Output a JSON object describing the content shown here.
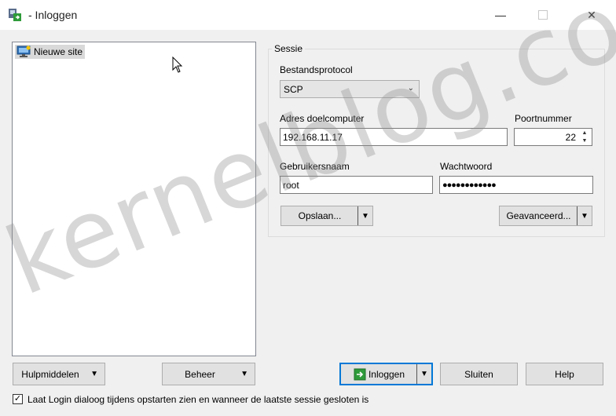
{
  "window": {
    "title": "- Inloggen",
    "minimize_glyph": "—",
    "close_glyph": "✕"
  },
  "tree": {
    "items": [
      {
        "label": "Nieuwe site",
        "icon": "monitor-icon"
      }
    ]
  },
  "session": {
    "group_title": "Sessie",
    "protocol_label": "Bestandsprotocol",
    "protocol_value": "SCP",
    "host_label": "Adres doelcomputer",
    "host_value": "192.168.11.17",
    "port_label": "Poortnummer",
    "port_value": "22",
    "user_label": "Gebruikersnaam",
    "user_value": "root",
    "password_label": "Wachtwoord",
    "password_value": "●●●●●●●●●●●●",
    "save_label": "Opslaan...",
    "advanced_label": "Geavanceerd..."
  },
  "bottom": {
    "tools_label": "Hulpmiddelen",
    "manage_label": "Beheer",
    "login_label": "Inloggen",
    "close_label": "Sluiten",
    "help_label": "Help"
  },
  "options": {
    "show_login_checked": true,
    "show_login_label": "Laat Login dialoog tijdens opstarten zien en wanneer de laatste sessie gesloten is"
  },
  "watermark": "kernelblog.co",
  "colors": {
    "accent": "#0078d7",
    "login_icon": "#2e9b3a"
  }
}
